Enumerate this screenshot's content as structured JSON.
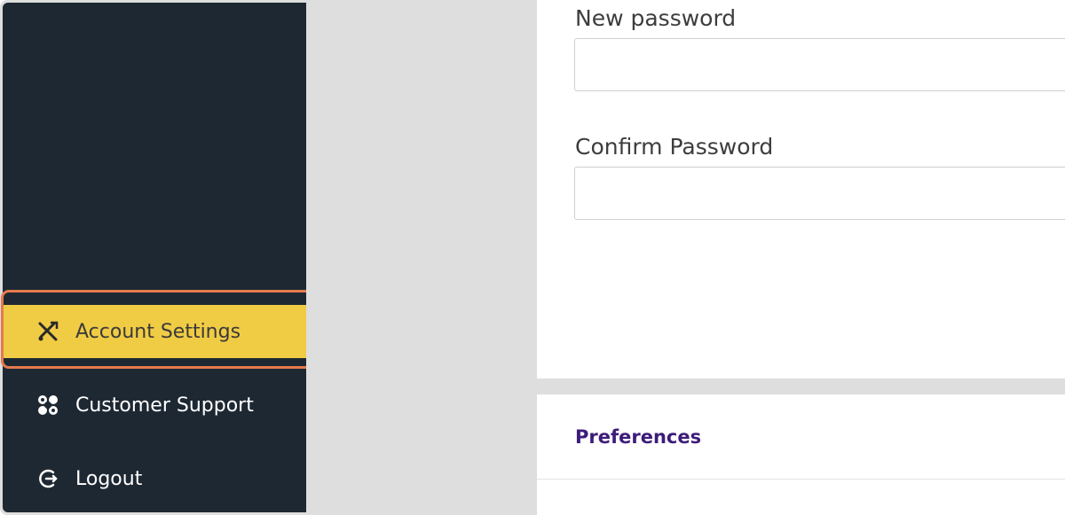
{
  "sidebar": {
    "items": [
      {
        "label": "Account Settings",
        "icon": "tools-icon",
        "active": true
      },
      {
        "label": "Customer Support",
        "icon": "support-icon",
        "active": false
      },
      {
        "label": "Logout",
        "icon": "logout-icon",
        "active": false
      }
    ]
  },
  "form": {
    "new_password_label": "New password",
    "new_password_value": "",
    "confirm_password_label": "Confirm Password",
    "confirm_password_value": ""
  },
  "preferences": {
    "title": "Preferences"
  },
  "colors": {
    "sidebar_bg": "#1e2833",
    "active_item_bg": "#f0cb44",
    "highlight_ring": "#e57a4e",
    "section_title": "#3d1c79"
  }
}
